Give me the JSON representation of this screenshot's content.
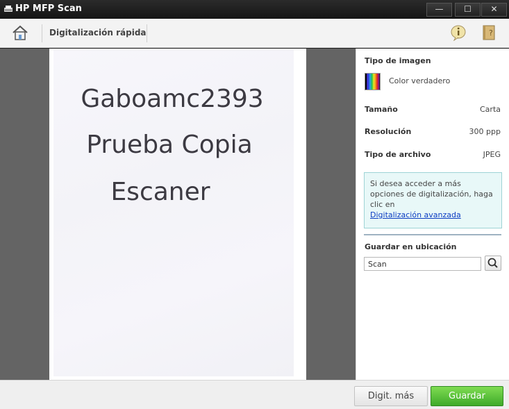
{
  "window": {
    "title": "HP MFP Scan",
    "minimize_glyph": "—",
    "maximize_glyph": "☐",
    "close_glyph": "✕"
  },
  "toolbar": {
    "mode_label": "Digitalización rápida",
    "icons": [
      "home-icon",
      "info-icon",
      "help-book-icon"
    ]
  },
  "preview": {
    "scanned_text": [
      "Gaboamc2393",
      "Prueba Copia",
      "Escaner"
    ]
  },
  "settings": {
    "image_type_title": "Tipo de imagen",
    "image_type_value": "Color verdadero",
    "size_title": "Tamaño",
    "size_value": "Carta",
    "resolution_title": "Resolución",
    "resolution_value": "300 ppp",
    "file_type_title": "Tipo de archivo",
    "file_type_value": "JPEG",
    "advanced_text": "Si desea acceder a más opciones de digitalización, haga clic en",
    "advanced_link": "Digitalización avanzada",
    "save_location_title": "Guardar en ubicación",
    "save_location_value": "Scan"
  },
  "buttons": {
    "scan_more": "Digit. más",
    "save": "Guardar"
  },
  "colors": {
    "save_button": "#4cb733",
    "titlebar": "#1d1d1d",
    "preview_background": "#646464",
    "info_box": "#e8f8f8",
    "link": "#0b3cc2"
  }
}
